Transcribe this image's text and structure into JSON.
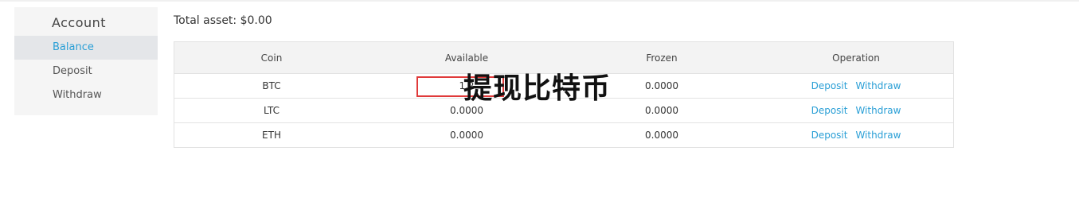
{
  "sidebar": {
    "title": "Account",
    "items": [
      {
        "label": "Balance",
        "active": true
      },
      {
        "label": "Deposit",
        "active": false
      },
      {
        "label": "Withdraw",
        "active": false
      }
    ]
  },
  "summary": {
    "total_asset": "Total asset: $0.00"
  },
  "table": {
    "headers": [
      "Coin",
      "Available",
      "Frozen",
      "Operation"
    ],
    "rows": [
      {
        "coin": "BTC",
        "available": "1.2",
        "frozen": "0.0000",
        "deposit": "Deposit",
        "withdraw": "Withdraw"
      },
      {
        "coin": "LTC",
        "available": "0.0000",
        "frozen": "0.0000",
        "deposit": "Deposit",
        "withdraw": "Withdraw"
      },
      {
        "coin": "ETH",
        "available": "0.0000",
        "frozen": "0.0000",
        "deposit": "Deposit",
        "withdraw": "Withdraw"
      }
    ]
  },
  "overlay": {
    "text": "提现比特币",
    "highlight_color": "#e03a3a"
  },
  "colors": {
    "accent": "#2a9fd6",
    "sidebar_bg": "#f5f5f5",
    "active_bg": "#e4e6e9"
  }
}
